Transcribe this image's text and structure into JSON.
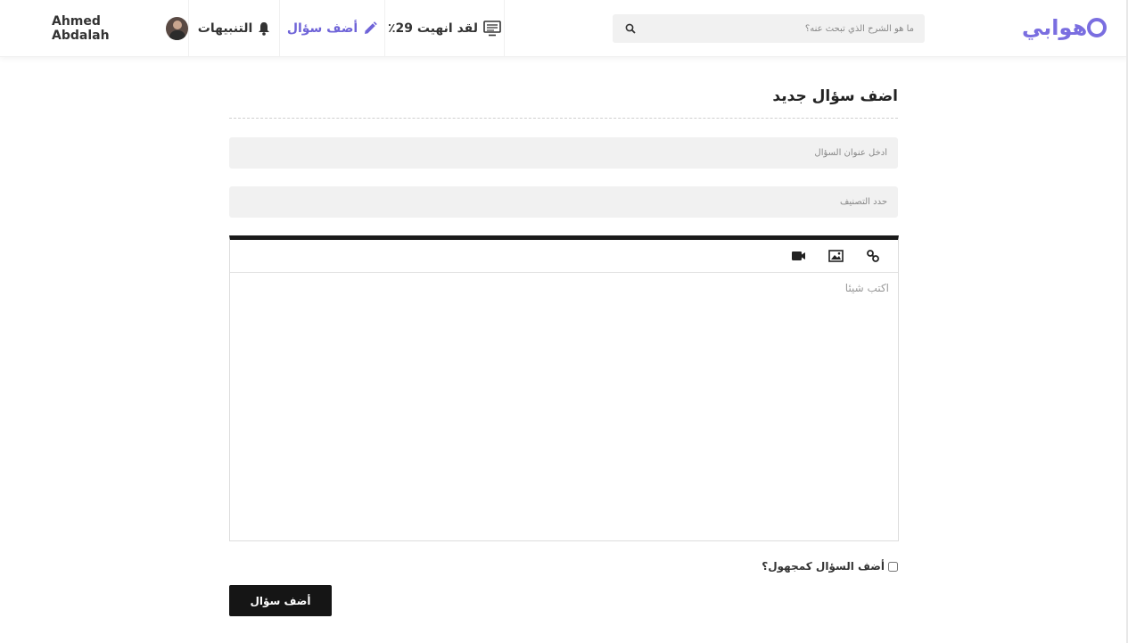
{
  "header": {
    "logo_text": "هوابي",
    "search": {
      "placeholder": "ما هو الشرح الذي تبحث عنه؟"
    },
    "progress_label": "لقد انهيت 29٪",
    "add_question_label": "أضف سؤال",
    "notifications_label": "التنبيهات",
    "user_name": "Ahmed Abdalah"
  },
  "main": {
    "title": "اضف سؤال جديد",
    "title_placeholder": "أدخل عنوان السؤال",
    "category_placeholder": "حدد التصنيف",
    "editor_placeholder": "اكتب شيئا",
    "anonymous_label": "أضف السؤال كمجهول؟",
    "submit_label": "أضف سؤال"
  },
  "colors": {
    "accent": "#6f64d8",
    "button_bg": "#151515",
    "field_bg": "#f1f1f1"
  }
}
